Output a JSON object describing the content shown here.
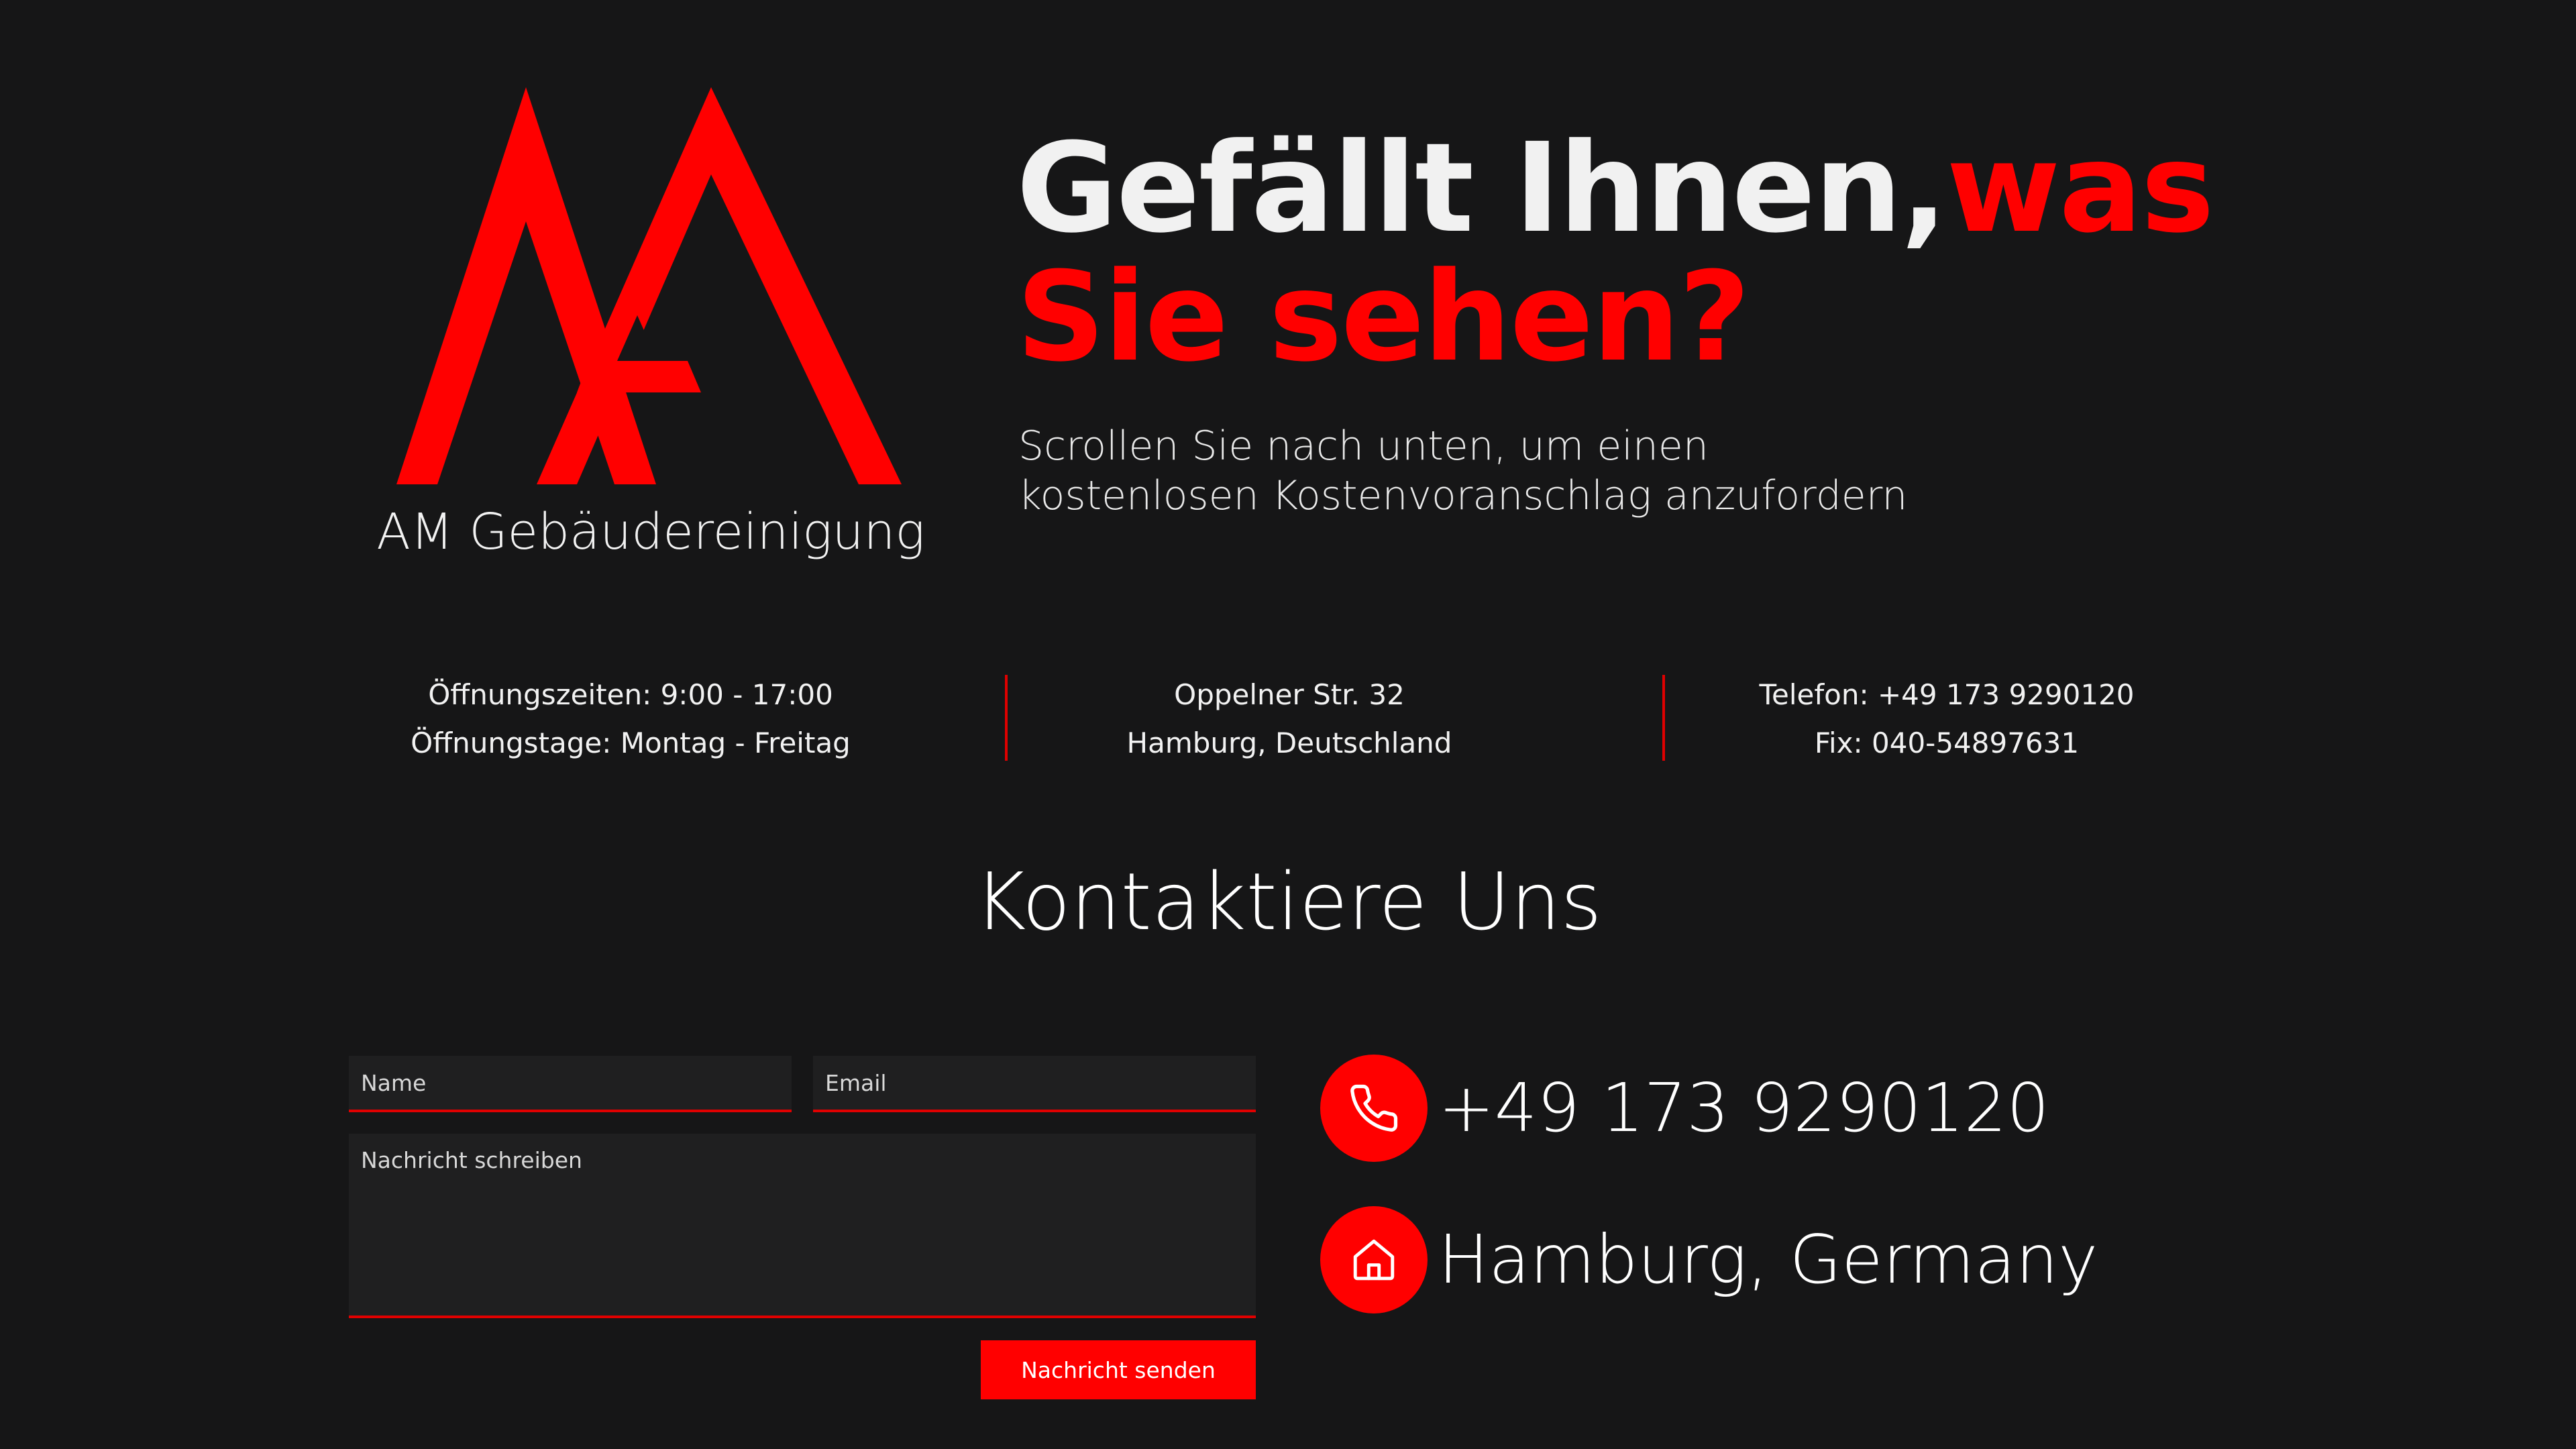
{
  "brand": {
    "name": "AM Gebäudereinigung",
    "logo_icon": "am-mountain-logo",
    "accent_color": "#ff0000"
  },
  "hero": {
    "title_part1": "Gefällt Ihnen,",
    "title_part2": "was",
    "title_line2": "Sie sehen?",
    "subtitle_line1": "Scrollen Sie nach unten, um einen",
    "subtitle_line2": "kostenlosen Kostenvoranschlag anzufordern"
  },
  "info": {
    "hours": "Öffnungszeiten: 9:00 - 17:00",
    "days": "Öffnungstage: Montag - Freitag",
    "street": "Oppelner Str. 32",
    "city": "Hamburg, Deutschland",
    "phone": "Telefon: +49 173 9290120",
    "fix": "Fix: 040-54897631"
  },
  "contact": {
    "title": "Kontaktiere Uns",
    "form": {
      "name_placeholder": "Name",
      "email_placeholder": "Email",
      "message_placeholder": "Nachricht schreiben",
      "submit_label": "Nachricht senden"
    },
    "items": [
      {
        "icon": "phone-icon",
        "text": "+49 173 9290120"
      },
      {
        "icon": "home-icon",
        "text": "Hamburg, Germany"
      }
    ]
  }
}
